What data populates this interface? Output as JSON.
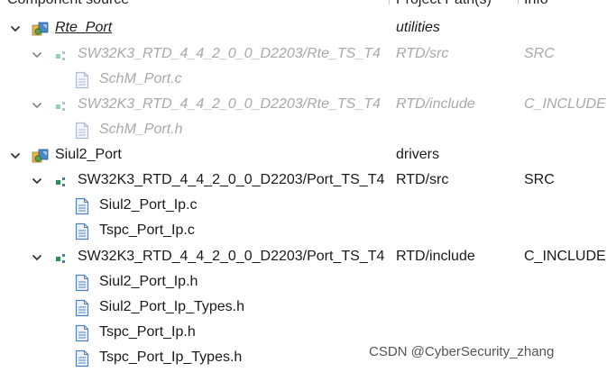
{
  "columns": {
    "component": "Component source",
    "path": "Project Path(s)",
    "info": "Info"
  },
  "tree": [
    {
      "kind": "component",
      "label": "Rte_Port",
      "path": "utilities",
      "info": "",
      "dim": false,
      "italic": true,
      "underline": true
    },
    {
      "kind": "folder",
      "label": "SW32K3_RTD_4_4_2_0_0_D2203/Rte_TS_T4",
      "path": "RTD/src",
      "info": "SRC",
      "dim": true
    },
    {
      "kind": "file",
      "label": "SchM_Port.c",
      "path": "",
      "info": "",
      "dim": true
    },
    {
      "kind": "folder",
      "label": "SW32K3_RTD_4_4_2_0_0_D2203/Rte_TS_T4",
      "path": "RTD/include",
      "info": "C_INCLUDE",
      "dim": true
    },
    {
      "kind": "file",
      "label": "SchM_Port.h",
      "path": "",
      "info": "",
      "dim": true
    },
    {
      "kind": "component",
      "label": "Siul2_Port",
      "path": "drivers",
      "info": "",
      "dim": false,
      "italic": false,
      "underline": false
    },
    {
      "kind": "folder",
      "label": "SW32K3_RTD_4_4_2_0_0_D2203/Port_TS_T4",
      "path": "RTD/src",
      "info": "SRC",
      "dim": false
    },
    {
      "kind": "file",
      "label": "Siul2_Port_Ip.c",
      "path": "",
      "info": "",
      "dim": false
    },
    {
      "kind": "file",
      "label": "Tspc_Port_Ip.c",
      "path": "",
      "info": "",
      "dim": false
    },
    {
      "kind": "folder",
      "label": "SW32K3_RTD_4_4_2_0_0_D2203/Port_TS_T4",
      "path": "RTD/include",
      "info": "C_INCLUDE",
      "dim": false
    },
    {
      "kind": "file",
      "label": "Siul2_Port_Ip.h",
      "path": "",
      "info": "",
      "dim": false
    },
    {
      "kind": "file",
      "label": "Siul2_Port_Ip_Types.h",
      "path": "",
      "info": "",
      "dim": false
    },
    {
      "kind": "file",
      "label": "Tspc_Port_Ip.h",
      "path": "",
      "info": "",
      "dim": false
    },
    {
      "kind": "file",
      "label": "Tspc_Port_Ip_Types.h",
      "path": "",
      "info": "",
      "dim": false
    }
  ],
  "icons": {
    "component": "component-icon",
    "folder": "source-folder-icon",
    "file": "file-icon",
    "chevron": "chevron-down-icon"
  },
  "colors": {
    "dim_text": "#a9a9a9",
    "file_icon_blue": "#4f81bd",
    "folder_green": "#2e8b57",
    "folder_blue": "#3c78d8"
  },
  "watermark": "CSDN @CyberSecurity_zhang"
}
